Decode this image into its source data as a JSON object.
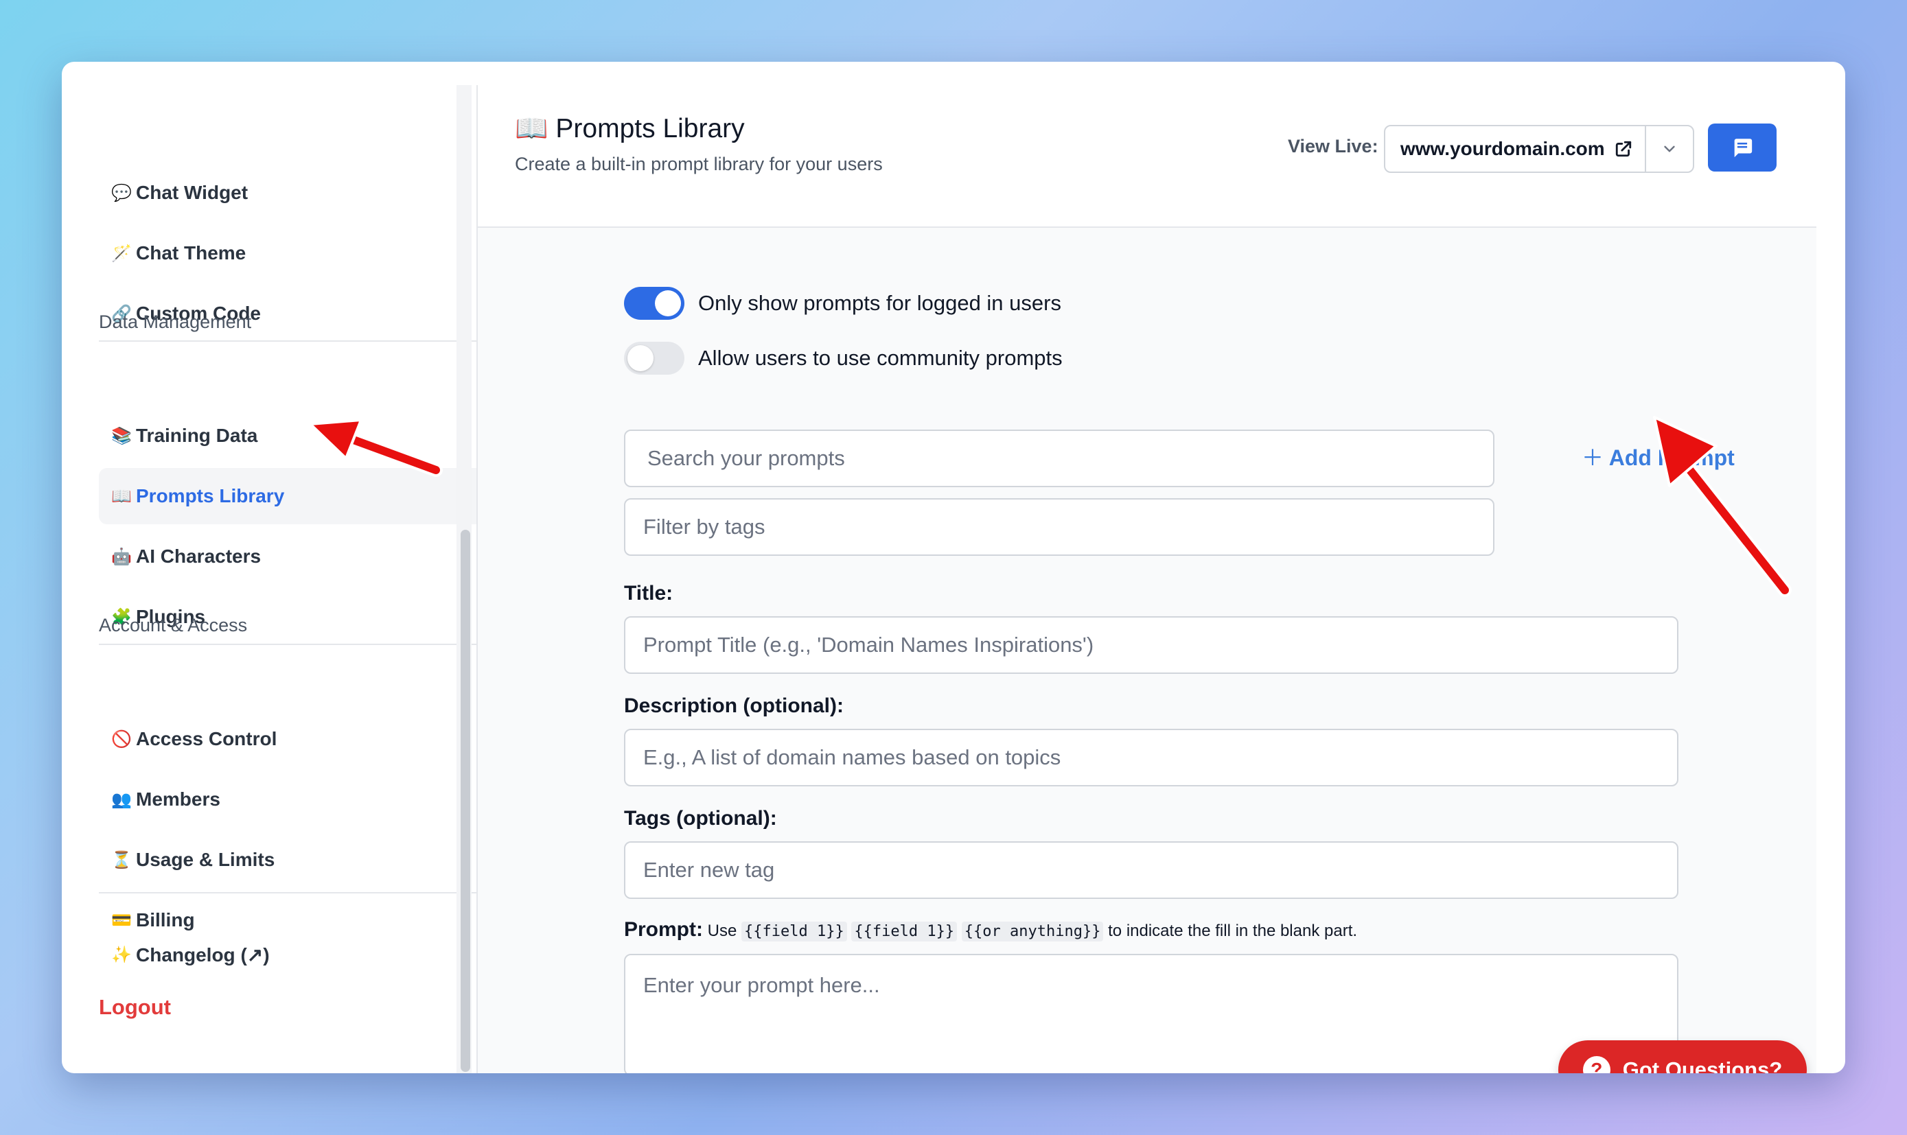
{
  "sidebar": {
    "items_top": [
      {
        "emoji": "💬",
        "label": "Chat Widget"
      },
      {
        "emoji": "🪄",
        "label": "Chat Theme"
      },
      {
        "emoji": "🔗",
        "label": "Custom Code"
      }
    ],
    "sections": [
      {
        "title": "Data Management",
        "items": [
          {
            "emoji": "📚",
            "label": "Training Data"
          },
          {
            "emoji": "📖",
            "label": "Prompts Library",
            "active": true
          },
          {
            "emoji": "🤖",
            "label": "AI Characters"
          },
          {
            "emoji": "🧩",
            "label": "Plugins"
          }
        ]
      },
      {
        "title": "Account & Access",
        "items": [
          {
            "emoji": "🚫",
            "label": "Access Control"
          },
          {
            "emoji": "👥",
            "label": "Members"
          },
          {
            "emoji": "⏳",
            "label": "Usage & Limits"
          },
          {
            "emoji": "💳",
            "label": "Billing"
          }
        ]
      }
    ],
    "changelog": {
      "emoji": "✨",
      "label": "Changelog (↗)"
    },
    "logout": "Logout"
  },
  "header": {
    "title_emoji": "📖",
    "title": "Prompts Library",
    "subtitle": "Create a built-in prompt library for your users",
    "view_live_label": "View Live:",
    "domain": "www.yourdomain.com"
  },
  "content": {
    "toggles": [
      {
        "label": "Only show prompts for logged in users",
        "on": true
      },
      {
        "label": "Allow users to use community prompts",
        "on": false
      }
    ],
    "search_placeholder": "Search your prompts",
    "filter_placeholder": "Filter by tags",
    "add_prompt": "Add Prompt",
    "title_label": "Title:",
    "title_placeholder": "Prompt Title (e.g., 'Domain Names Inspirations')",
    "description_label": "Description (optional):",
    "description_placeholder": "E.g., A list of domain names based on topics",
    "tags_label": "Tags (optional):",
    "tags_placeholder": "Enter new tag",
    "prompt_label": "Prompt:",
    "prompt_hint_prefix": "Use",
    "prompt_hint_codes": [
      "{{field 1}}",
      "{{field 1}}",
      "{{or anything}}"
    ],
    "prompt_hint_suffix": "to indicate the fill in the blank part.",
    "prompt_placeholder": "Enter your prompt here...",
    "got_questions": "Got Questions?"
  },
  "colors": {
    "accent": "#2d6be4",
    "danger": "#dc2626",
    "annotation_arrow": "#e8100f"
  },
  "icons": [
    "external-link-icon",
    "chevron-down-icon",
    "chat-icon",
    "plus-icon",
    "question-icon"
  ]
}
